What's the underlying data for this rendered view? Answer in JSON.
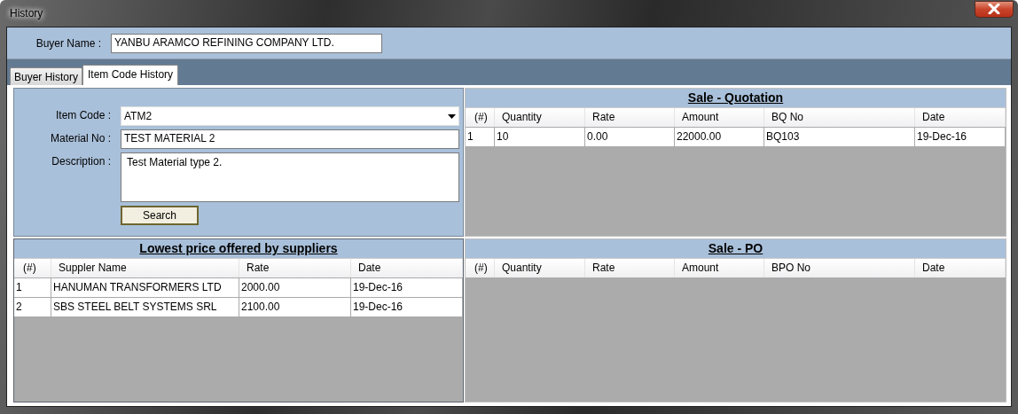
{
  "window": {
    "title": "History"
  },
  "buyer": {
    "label": "Buyer Name :",
    "value": "YANBU ARAMCO REFINING COMPANY LTD."
  },
  "tabs": [
    {
      "label": "Buyer History",
      "selected": false
    },
    {
      "label": "Item Code History",
      "selected": true
    }
  ],
  "item_form": {
    "item_code": {
      "label": "Item Code :",
      "value": "ATM2"
    },
    "material_no": {
      "label": "Material No :",
      "value": "TEST MATERIAL 2"
    },
    "description": {
      "label": "Description :",
      "value": "Test Material type 2."
    },
    "search_button": "Search"
  },
  "suppliers_table": {
    "title": "Lowest price offered by suppliers",
    "columns": [
      "(#)",
      "Suppler Name",
      "Rate",
      "Date"
    ],
    "rows": [
      [
        "1",
        "HANUMAN TRANSFORMERS LTD",
        "2000.00",
        "19-Dec-16"
      ],
      [
        "2",
        "SBS STEEL BELT SYSTEMS SRL",
        "2100.00",
        "19-Dec-16"
      ]
    ]
  },
  "sale_quotation": {
    "title": "Sale - Quotation",
    "columns": [
      "(#)",
      "Quantity",
      "Rate",
      "Amount",
      "BQ No",
      "Date"
    ],
    "rows": [
      [
        "1",
        "10",
        "0.00",
        "22000.00",
        "BQ103",
        "19-Dec-16"
      ]
    ]
  },
  "sale_po": {
    "title": "Sale - PO",
    "columns": [
      "(#)",
      "Quantity",
      "Rate",
      "Amount",
      "BPO No",
      "Date"
    ]
  }
}
